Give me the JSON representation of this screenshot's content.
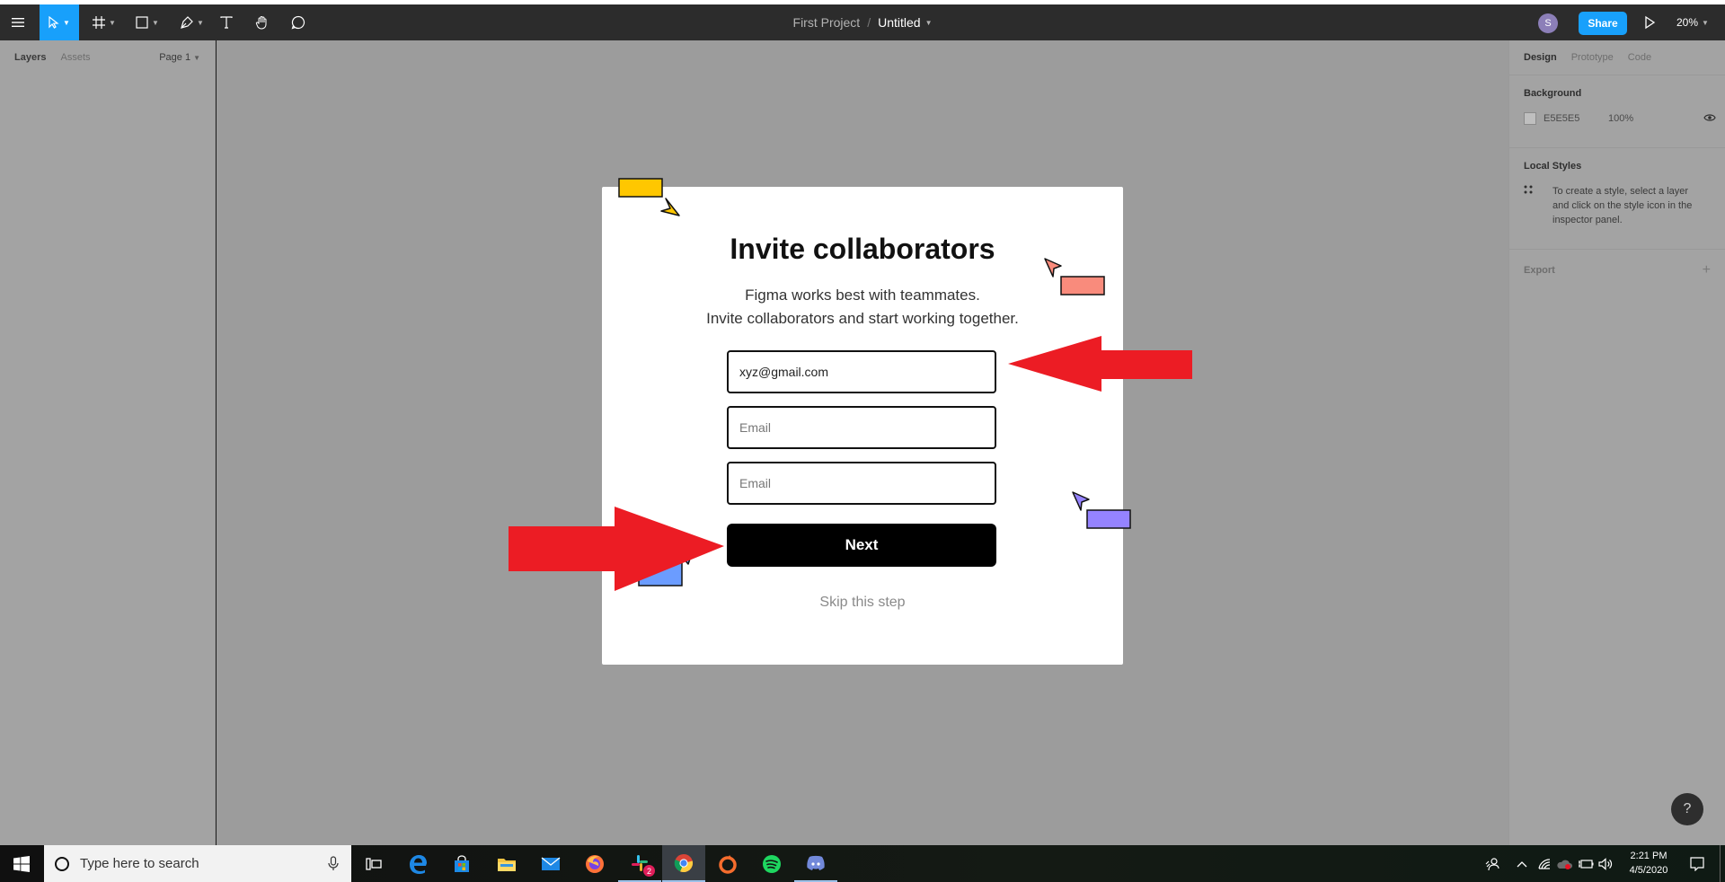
{
  "toolbar": {
    "project": "First Project",
    "separator": "/",
    "file": "Untitled",
    "avatar_initial": "S",
    "share_label": "Share",
    "zoom": "20%"
  },
  "left_panel": {
    "tabs": [
      "Layers",
      "Assets"
    ],
    "page": "Page 1"
  },
  "right_panel": {
    "tabs": [
      "Design",
      "Prototype",
      "Code"
    ],
    "background_heading": "Background",
    "bg_hex": "E5E5E5",
    "bg_opacity": "100%",
    "local_styles_heading": "Local Styles",
    "local_styles_hint": "To create a style, select a layer and click on the style icon in the inspector panel.",
    "export_heading": "Export"
  },
  "modal": {
    "title": "Invite collaborators",
    "subtitle_line1": "Figma works best with teammates.",
    "subtitle_line2": "Invite collaborators and start working together.",
    "email1_value": "xyz@gmail.com",
    "email_placeholder": "Email",
    "next_label": "Next",
    "skip_label": "Skip this step"
  },
  "help_label": "?",
  "taskbar": {
    "search_placeholder": "Type here to search",
    "slack_badge": "2",
    "time": "2:21 PM",
    "date": "4/5/2020"
  },
  "colors": {
    "accent": "#18a0fb",
    "annotation_arrow": "#ec1c24",
    "deco_yellow": "#ffc700",
    "deco_salmon": "#f98b7c",
    "deco_purple": "#9583ff",
    "deco_blue": "#6b9cff"
  }
}
